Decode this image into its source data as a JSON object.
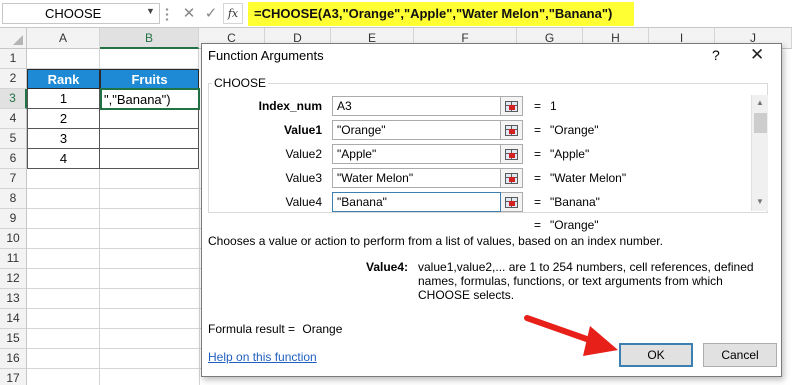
{
  "formula_bar": {
    "name_box": "CHOOSE",
    "fx_label": "fx",
    "cancel_glyph": "✕",
    "enter_glyph": "✓",
    "formula": "=CHOOSE(A3,\"Orange\",\"Apple\",\"Water Melon\",\"Banana\")",
    "highlight_color": "#ffff33"
  },
  "sheet": {
    "columns": [
      "A",
      "B",
      "C",
      "D",
      "E",
      "F",
      "G",
      "H",
      "I",
      "J"
    ],
    "rows": [
      "1",
      "2",
      "3",
      "4",
      "5",
      "6",
      "7",
      "8",
      "9",
      "10",
      "11",
      "12",
      "13",
      "14",
      "15",
      "16",
      "17"
    ],
    "table": {
      "header_rank": "Rank",
      "header_fruits": "Fruits",
      "header_color": "#1e8ad6",
      "ranks": [
        "1",
        "2",
        "3",
        "4"
      ],
      "active_cell_text": "\",\"Banana\")"
    }
  },
  "dialog": {
    "title": "Function Arguments",
    "help_glyph": "?",
    "close_glyph": "✕",
    "function_name": "CHOOSE",
    "args": [
      {
        "label": "Index_num",
        "value": "A3",
        "result": "1",
        "bold": true
      },
      {
        "label": "Value1",
        "value": "\"Orange\"",
        "result": "\"Orange\"",
        "bold": true
      },
      {
        "label": "Value2",
        "value": "\"Apple\"",
        "result": "\"Apple\"",
        "bold": false
      },
      {
        "label": "Value3",
        "value": "\"Water Melon\"",
        "result": "\"Water Melon\"",
        "bold": false
      },
      {
        "label": "Value4",
        "value": "\"Banana\"",
        "result": "\"Banana\"",
        "bold": false
      }
    ],
    "equals": "=",
    "overall_result": "\"Orange\"",
    "description": "Chooses a value or action to perform from a list of values, based on an index number.",
    "value4_label": "Value4:",
    "value4_description": "value1,value2,... are 1 to 254 numbers, cell references, defined names, formulas, functions, or text arguments from which CHOOSE selects.",
    "formula_result_label": "Formula result =",
    "formula_result_value": "Orange",
    "help_link": "Help on this function",
    "ok_label": "OK",
    "cancel_label": "Cancel"
  },
  "annotation": {
    "arrow_color": "#e8201a"
  }
}
